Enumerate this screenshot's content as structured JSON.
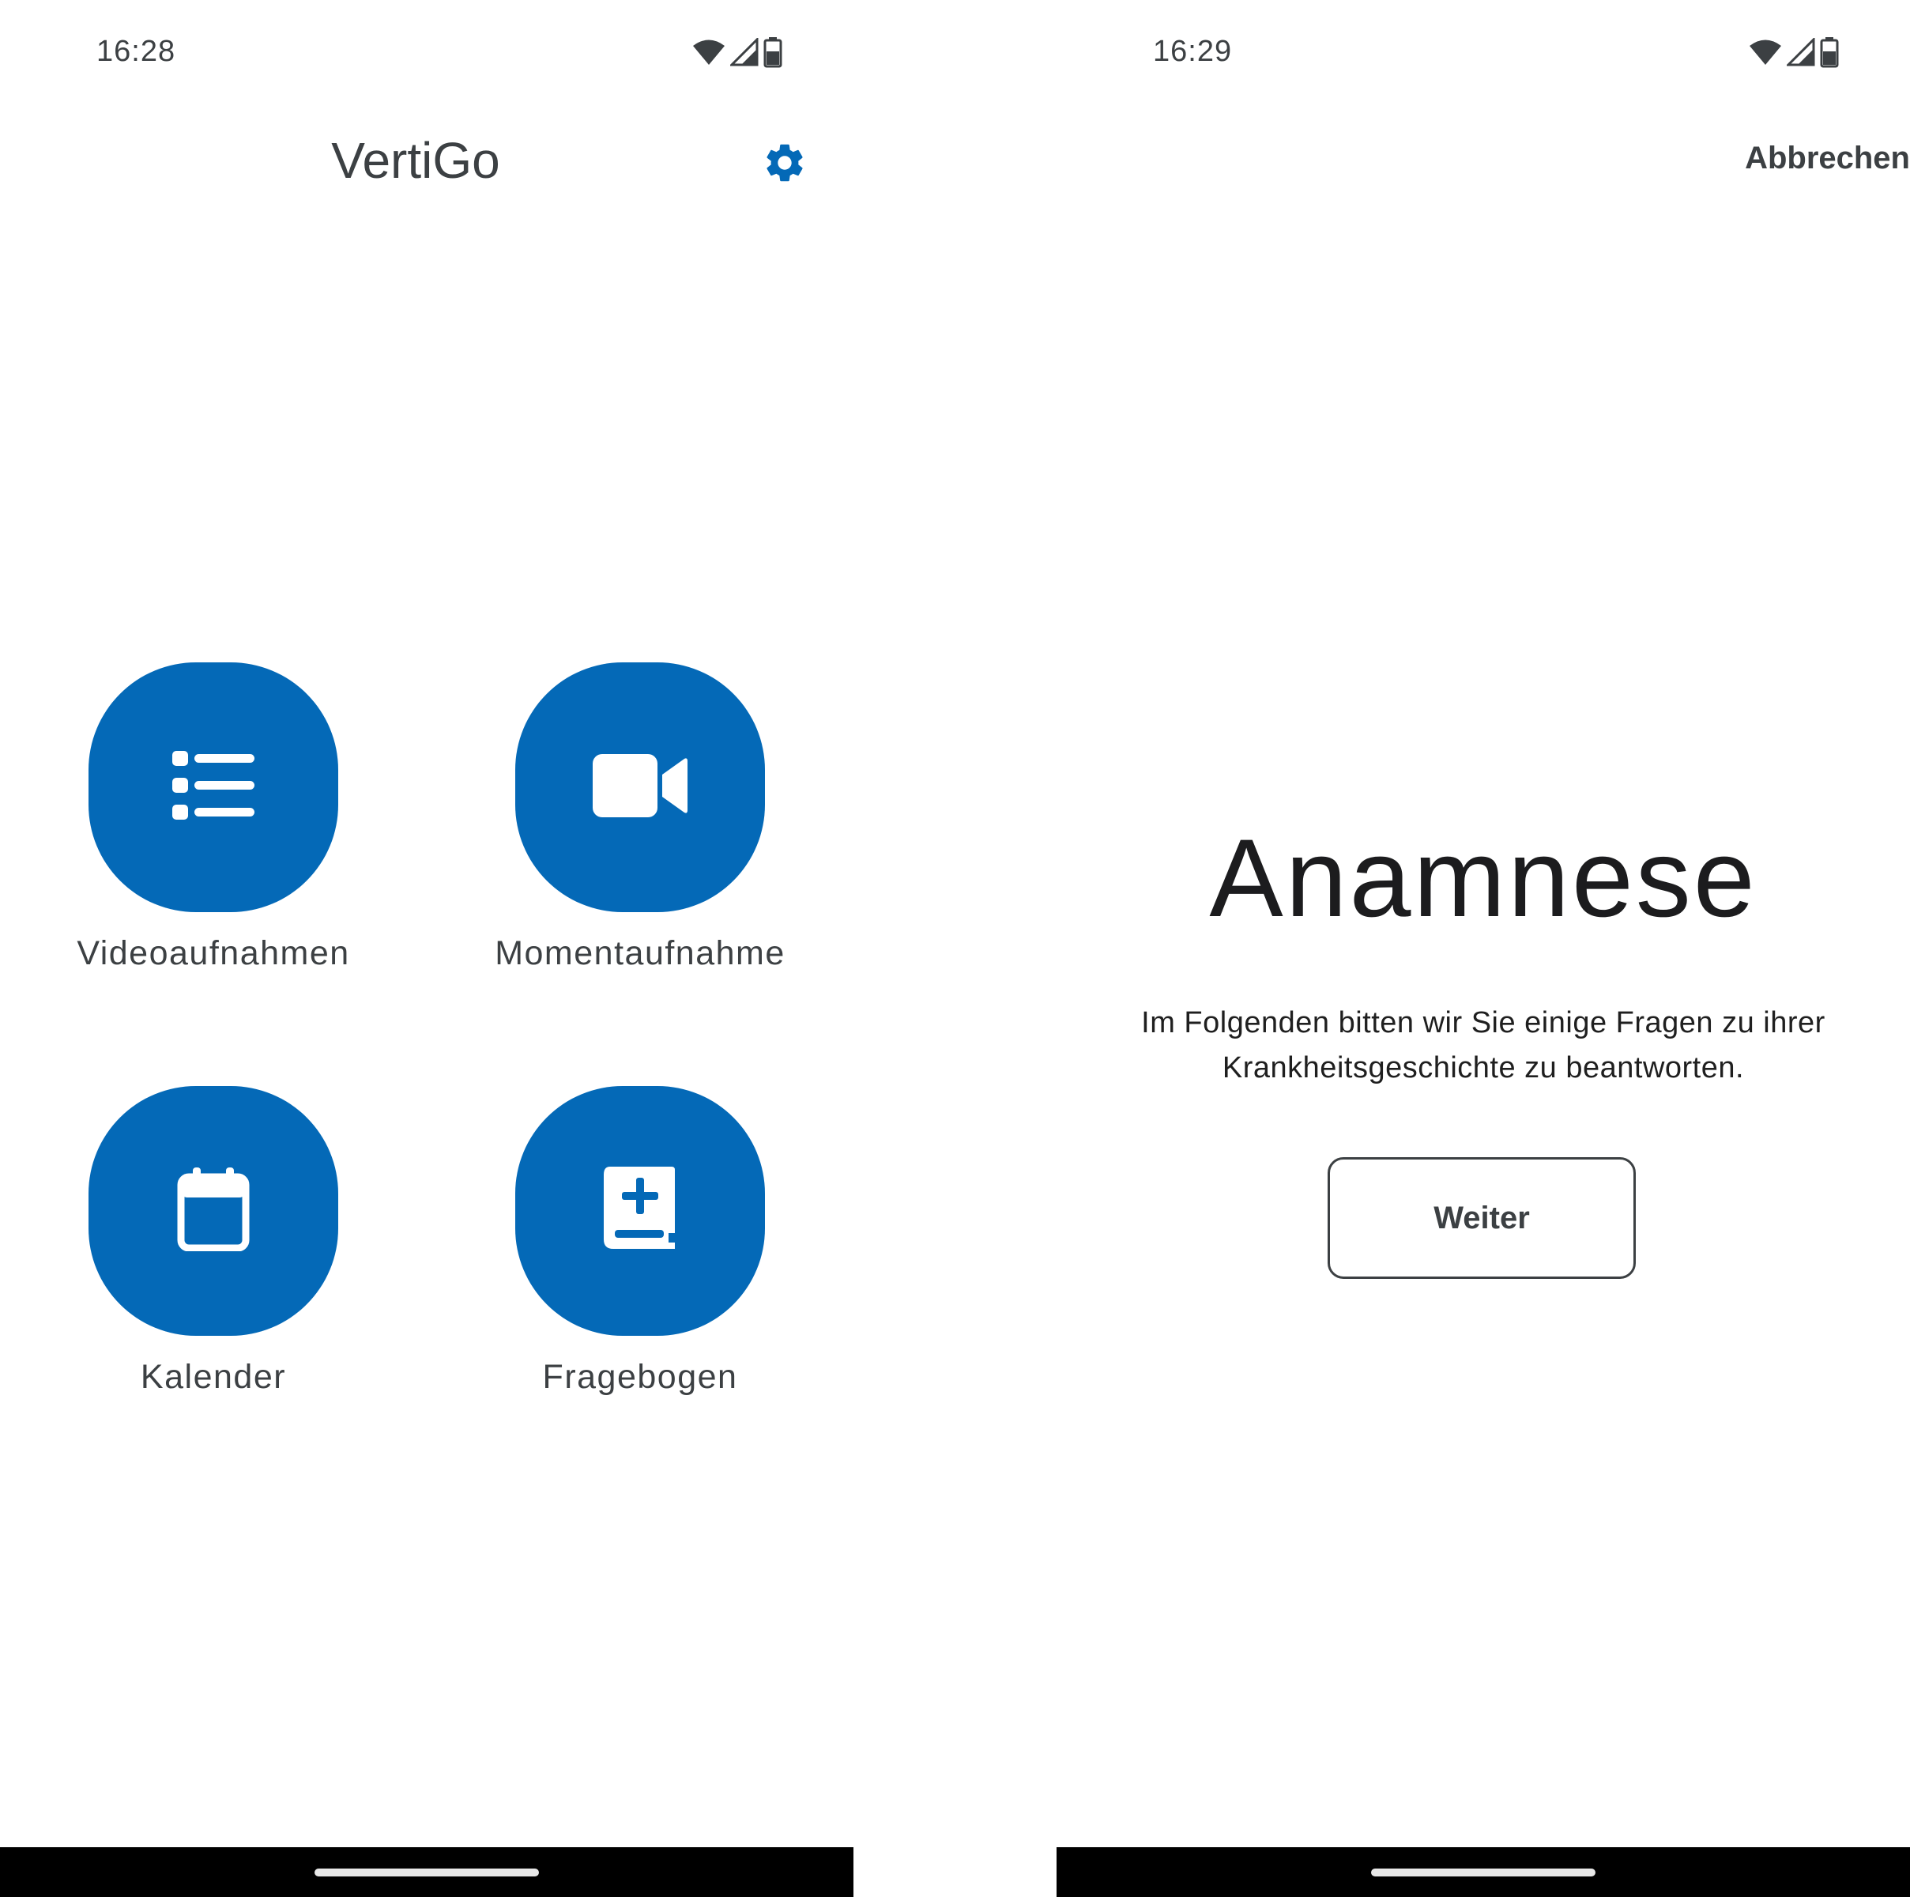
{
  "colors": {
    "accent": "#0469b7",
    "text_primary": "#3c4043",
    "heading": "#1c1c1e",
    "nav_bar": "#000000"
  },
  "home_screen": {
    "status_bar": {
      "time": "16:28",
      "icons": [
        "wifi-icon",
        "cellular-signal-icon",
        "battery-icon"
      ]
    },
    "header": {
      "title": "VertiGo",
      "settings_icon": "gear-icon"
    },
    "tiles": [
      {
        "label": "Videoaufnahmen",
        "icon": "list-icon"
      },
      {
        "label": "Momentaufnahme",
        "icon": "video-camera-icon"
      },
      {
        "label": "Kalender",
        "icon": "calendar-icon"
      },
      {
        "label": "Fragebogen",
        "icon": "medical-book-icon"
      }
    ]
  },
  "anamnese_screen": {
    "status_bar": {
      "time": "16:29",
      "icons": [
        "wifi-icon",
        "cellular-signal-icon",
        "battery-icon"
      ]
    },
    "cancel_label": "Abbrechen",
    "heading": "Anamnese",
    "intro_line1": "Im Folgenden bitten wir Sie einige Fragen zu ihrer",
    "intro_line2": "Krankheitsgeschichte zu beantworten.",
    "next_label": "Weiter"
  }
}
